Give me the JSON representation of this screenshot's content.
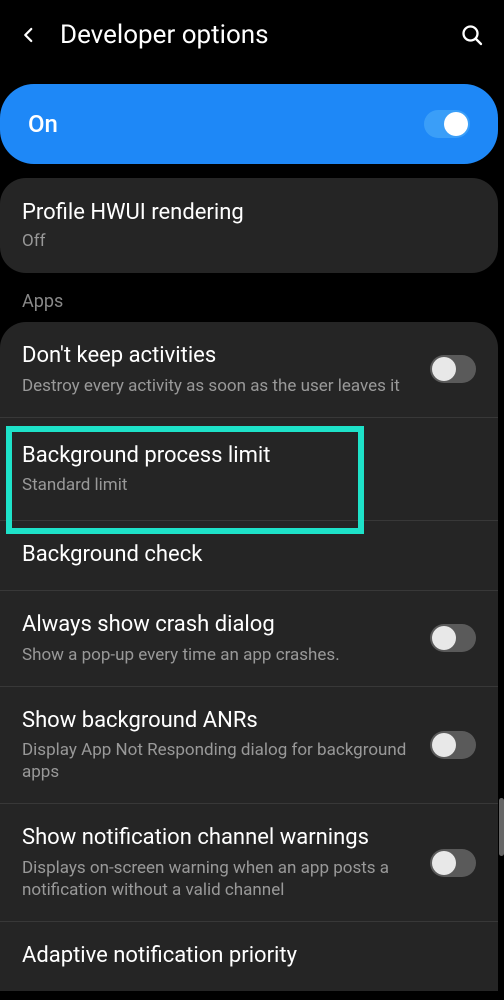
{
  "header": {
    "title": "Developer options"
  },
  "main_toggle": {
    "label": "On"
  },
  "profile_card": {
    "title": "Profile HWUI rendering",
    "sub": "Off"
  },
  "apps_section": {
    "label": "Apps",
    "items": [
      {
        "title": "Don't keep activities",
        "sub": "Destroy every activity as soon as the user leaves it"
      },
      {
        "title": "Background process limit",
        "sub": "Standard limit"
      },
      {
        "title": "Background check",
        "sub": ""
      },
      {
        "title": "Always show crash dialog",
        "sub": "Show a pop-up every time an app crashes."
      },
      {
        "title": "Show background ANRs",
        "sub": "Display App Not Responding dialog for background apps"
      },
      {
        "title": "Show notification channel warnings",
        "sub": "Displays on-screen warning when an app posts a notification without a valid channel"
      },
      {
        "title": "Adaptive notification priority",
        "sub": ""
      }
    ]
  }
}
